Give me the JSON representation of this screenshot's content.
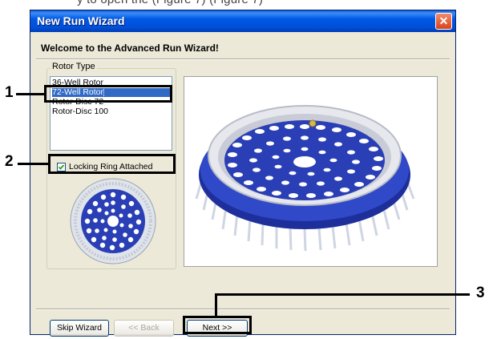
{
  "top_text": "y to open the (Figure 7) (Figure 7)",
  "window": {
    "title": "New Run Wizard",
    "close_glyph": "✕"
  },
  "welcome_text": "Welcome to the Advanced Run Wizard!",
  "rotor_type": {
    "label": "Rotor Type",
    "options": [
      "36-Well Rotor",
      "72-Well Rotor",
      "Rotor-Disc 72",
      "Rotor-Disc 100"
    ],
    "selected": "72-Well Rotor"
  },
  "locking_ring": {
    "label": "Locking Ring Attached",
    "checked": true
  },
  "buttons": {
    "skip": "Skip Wizard",
    "back": "<< Back",
    "next": "Next >>"
  },
  "callouts": {
    "n1": "1",
    "n2": "2",
    "n3": "3"
  },
  "colors": {
    "titlebar": "#0058e6",
    "selection": "#316ac5",
    "rotor_blue": "#2a3fb5"
  }
}
